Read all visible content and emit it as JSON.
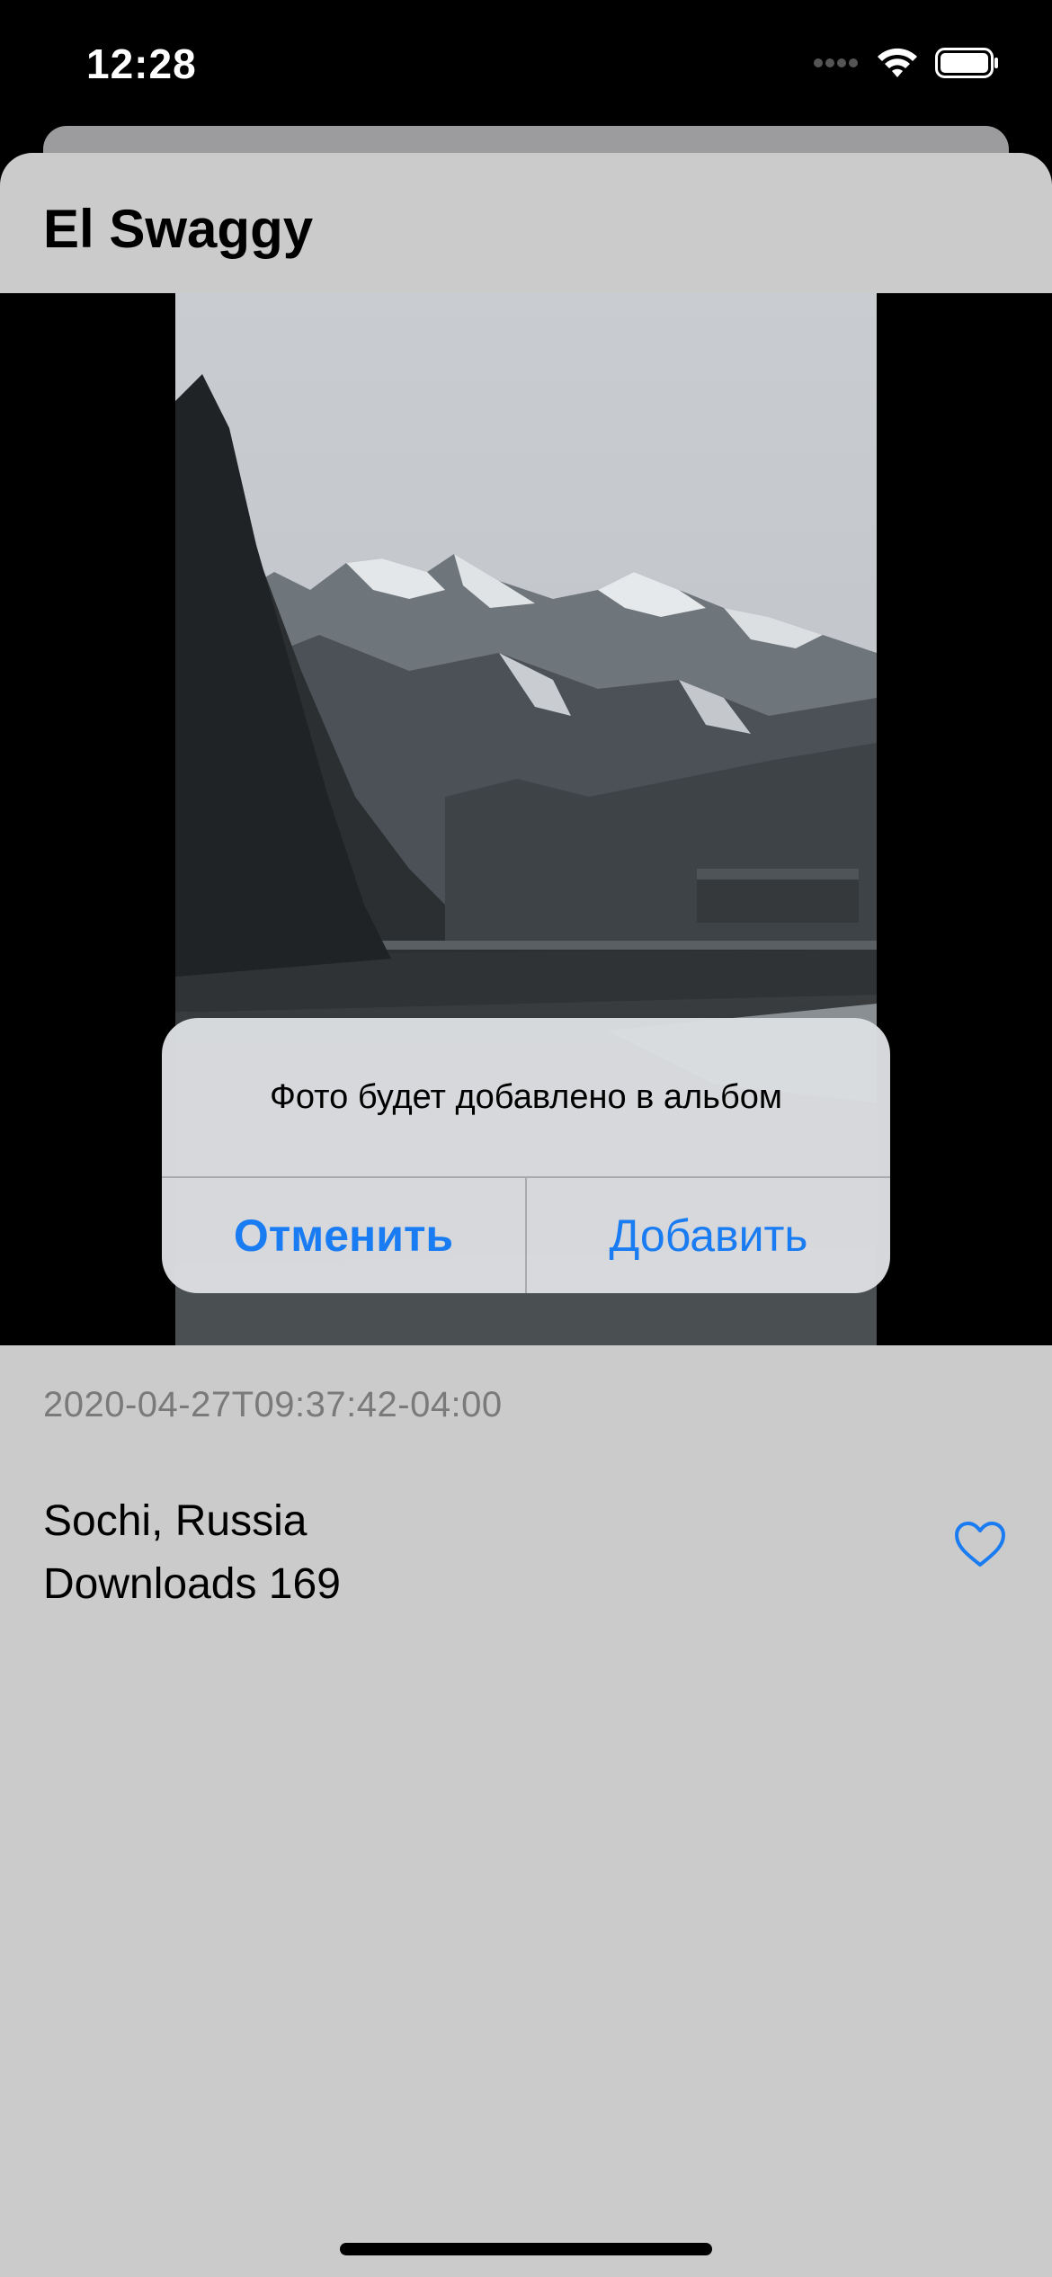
{
  "status_bar": {
    "time": "12:28"
  },
  "nav": {
    "title": "El Swaggy"
  },
  "photo": {
    "description_icon": "mountain-landscape-photo"
  },
  "details": {
    "date": "2020-04-27T09:37:42-04:00",
    "location": "Sochi, Russia",
    "downloads": "Downloads 169",
    "favorite_icon": "heart-outline-icon"
  },
  "alert": {
    "message": "Фото будет добавлено в альбом",
    "cancel_label": "Отменить",
    "add_label": "Добавить"
  },
  "colors": {
    "accent": "#1a7cf2",
    "sheet_background": "#cbcbcb",
    "secondary_text": "#7a7a7a"
  }
}
